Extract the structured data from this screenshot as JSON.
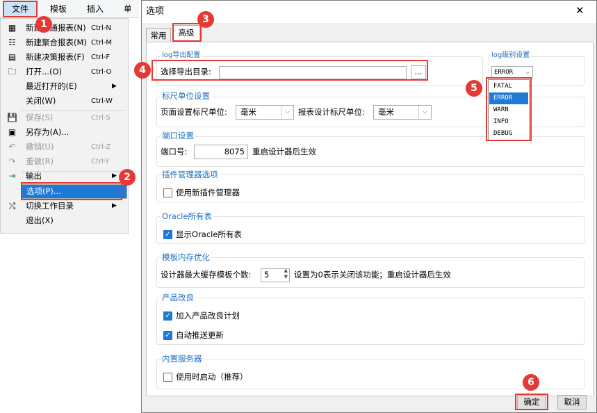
{
  "menubar": {
    "items": [
      "文件",
      "模板",
      "插入",
      "单"
    ]
  },
  "file_menu": {
    "items": [
      {
        "icon": "new-report-icon",
        "label": "新建普通报表(N)",
        "shortcut": "Ctrl-N",
        "disabled": false
      },
      {
        "icon": "new-aggregate-icon",
        "label": "新建聚合报表(M)",
        "shortcut": "Ctrl-M",
        "disabled": false
      },
      {
        "icon": "new-dashboard-icon",
        "label": "新建决策报表(F)",
        "shortcut": "Ctrl-F",
        "disabled": false
      },
      {
        "icon": "folder-open-icon",
        "label": "打开...(O)",
        "shortcut": "Ctrl-O",
        "disabled": false
      },
      {
        "icon": "",
        "label": "最近打开的(E)",
        "shortcut": "",
        "submenu": true,
        "disabled": false
      },
      {
        "icon": "",
        "label": "关闭(W)",
        "shortcut": "Ctrl-W",
        "disabled": false
      },
      {
        "icon": "save-icon",
        "label": "保存(S)",
        "shortcut": "Ctrl-S",
        "disabled": true
      },
      {
        "icon": "save-as-icon",
        "label": "另存为(A)...",
        "shortcut": "",
        "disabled": false
      },
      {
        "icon": "undo-icon",
        "label": "撤销(U)",
        "shortcut": "Ctrl-Z",
        "disabled": true
      },
      {
        "icon": "redo-icon",
        "label": "重做(R)",
        "shortcut": "Ctrl-Y",
        "disabled": true
      },
      {
        "icon": "export-icon",
        "label": "输出",
        "shortcut": "",
        "submenu": true,
        "disabled": false
      },
      {
        "icon": "",
        "label": "选项(P)...",
        "shortcut": "",
        "selected": true,
        "disabled": false
      },
      {
        "icon": "switch-dir-icon",
        "label": "切换工作目录",
        "shortcut": "",
        "submenu": true,
        "disabled": false
      },
      {
        "icon": "",
        "label": "退出(X)",
        "shortcut": "",
        "disabled": false
      }
    ]
  },
  "dialog": {
    "title": "选项",
    "close": "✕",
    "tabs": [
      "常用",
      "高级"
    ],
    "ok": "确定",
    "cancel": "取消"
  },
  "log_export": {
    "title": "log导出配置",
    "label": "选择导出目录:",
    "value": "",
    "browse": "..."
  },
  "log_level": {
    "title": "log级别设置",
    "selected": "ERROR",
    "options": [
      "FATAL",
      "ERROR",
      "WARN",
      "INFO",
      "DEBUG"
    ]
  },
  "ruler": {
    "title": "标尺单位设置",
    "page_label": "页面设置标尺单位:",
    "page_value": "毫米",
    "report_label": "报表设计标尺单位:",
    "report_value": "毫米"
  },
  "port": {
    "title": "端口设置",
    "label": "端口号:",
    "value": "8075",
    "note": "重启设计器后生效"
  },
  "plugin": {
    "title": "插件管理器选项",
    "checkbox": "使用新插件管理器",
    "checked": false
  },
  "oracle": {
    "title": "Oracle所有表",
    "checkbox": "显示Oracle所有表",
    "checked": true
  },
  "memory": {
    "title": "模板内存优化",
    "label": "设计器最大缓存模板个数:",
    "value": "5",
    "note": "设置为0表示关闭该功能；重启设计器后生效"
  },
  "improve": {
    "title": "产品改良",
    "cb1": "加入产品改良计划",
    "cb2": "自动推送更新"
  },
  "server": {
    "title": "内置服务器",
    "checkbox": "使用时启动（推荐）",
    "checked": false
  },
  "badges": [
    "1",
    "2",
    "3",
    "4",
    "5",
    "6"
  ],
  "colors": {
    "accent": "#1e7ad6",
    "highlight": "#e53935",
    "group_title": "#1e6fbf"
  }
}
